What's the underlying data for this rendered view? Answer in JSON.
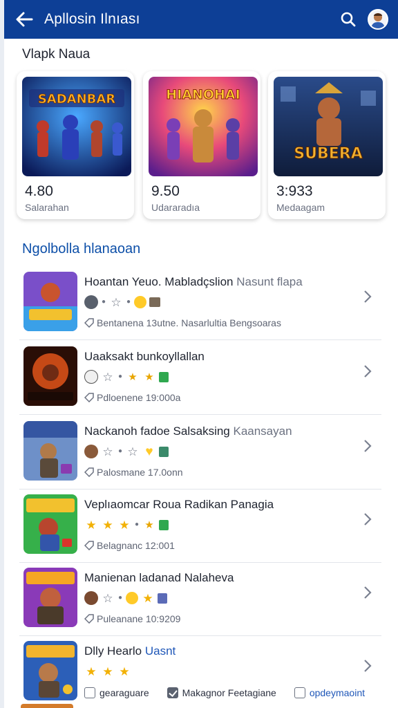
{
  "header": {
    "title": "Apllosin Ilnıası"
  },
  "featured": {
    "title": "Vlapk Naua",
    "cards": [
      {
        "rating": "4.80",
        "category": "Salarahan",
        "art_text": "SADANBAR"
      },
      {
        "rating": "9.50",
        "category": "Udararadıa",
        "art_text": "HIANOHAI"
      },
      {
        "rating": "3:933",
        "category": "Medaagam",
        "art_text": "SUBERA"
      }
    ]
  },
  "list": {
    "title": "Ngolbolla hlanaoan",
    "items": [
      {
        "name": "Hoantan Yeuo. Mabladçslion",
        "name_secondary": "Nasunt flapa",
        "meta": "Bentanena 13utne. Nasarlultia Bengsoaras"
      },
      {
        "name": "Uaaksakt bunkoyllallan",
        "meta": "Pdloenene 19:000a"
      },
      {
        "name": "Nackanoh fadoe Salsaksing",
        "name_secondary": "Kaansayan",
        "meta": "Palosmane 17.0onn"
      },
      {
        "name": "Veplıaomcar Roua Radikan Panagia",
        "meta": "Belagnanc 12:001"
      },
      {
        "name": "Manienan ladanad Nalaheva",
        "meta": "Puleanane 10:9209"
      },
      {
        "name": "Dlly Hearlo",
        "name_secondary": "Uasnt",
        "checks": [
          {
            "label": "gearaguare",
            "checked": false
          },
          {
            "label": "Makagnor Feetagiane",
            "checked": true
          },
          {
            "label": "opdeymaoint",
            "checked": false
          }
        ]
      }
    ]
  },
  "colors": {
    "header": "#0d3f96",
    "accent": "#0d4fa8",
    "star": "#f2b106"
  }
}
